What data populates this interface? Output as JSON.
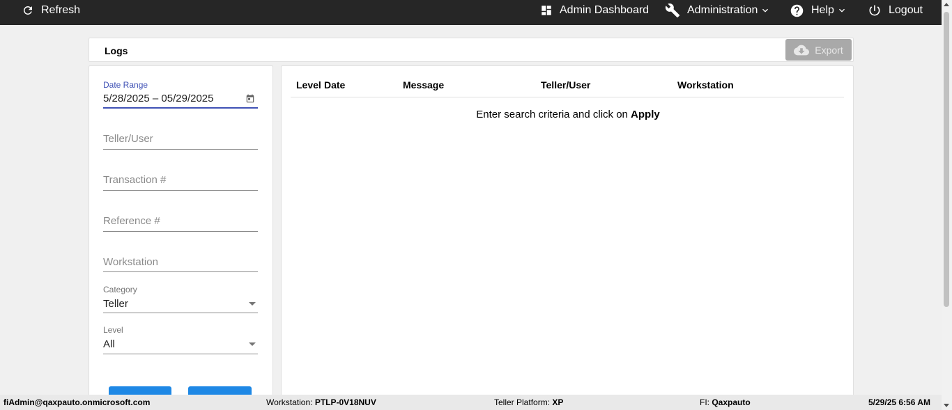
{
  "topbar": {
    "refresh": "Refresh",
    "admin_dashboard": "Admin Dashboard",
    "administration": "Administration",
    "help": "Help",
    "logout": "Logout",
    "bg_color": "#262626"
  },
  "header": {
    "title": "Logs",
    "export_label": "Export"
  },
  "filters": {
    "date_range_label": "Date Range",
    "date_range_value": "5/28/2025 – 05/29/2025",
    "teller_user_placeholder": "Teller/User",
    "transaction_placeholder": "Transaction #",
    "reference_placeholder": "Reference #",
    "workstation_placeholder": "Workstation",
    "category_label": "Category",
    "category_value": "Teller",
    "level_label": "Level",
    "level_value": "All",
    "accent_color": "#3f51b5",
    "button_color": "#1e88e5"
  },
  "results": {
    "columns": [
      "Level",
      "Date",
      "Message",
      "Teller/User",
      "Workstation"
    ],
    "empty_prefix": "Enter search criteria and click on ",
    "empty_action": "Apply"
  },
  "footer": {
    "user": "fiAdmin@qaxpauto.onmicrosoft.com",
    "workstation_label": "Workstation: ",
    "workstation_value": "PTLP-0V18NUV",
    "platform_label": "Teller Platform: ",
    "platform_value": "XP",
    "fi_label": "FI: ",
    "fi_value": "Qaxpauto",
    "datetime": "5/29/25 6:56 AM"
  }
}
